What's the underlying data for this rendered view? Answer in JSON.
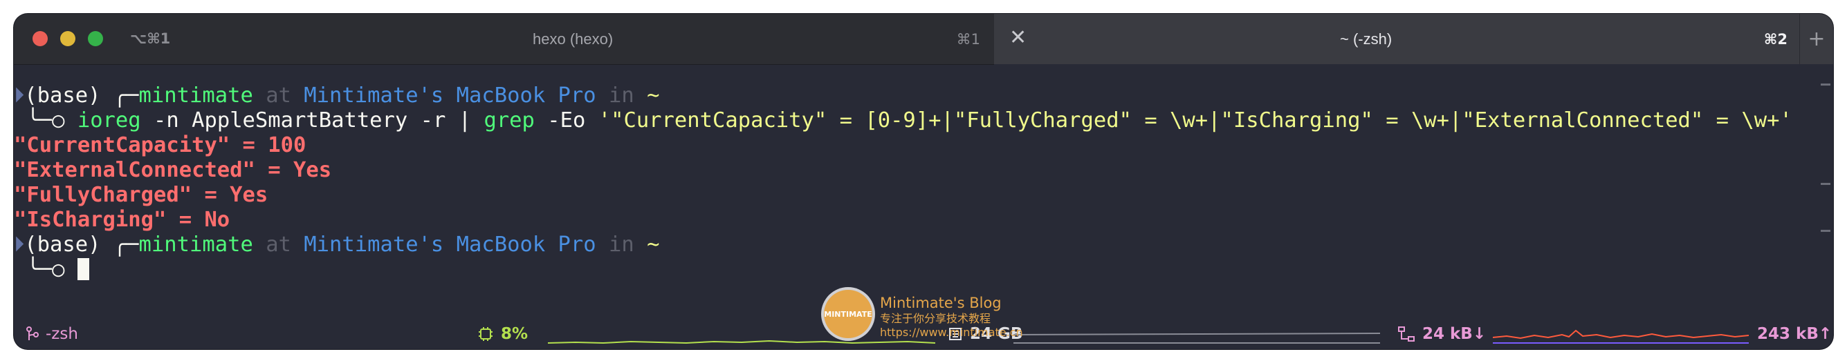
{
  "titlebar": {
    "left_tab": {
      "kbd_hint": "⌥⌘1",
      "title": "hexo (hexo)",
      "shortcut": "⌘1"
    },
    "right_tab": {
      "title": "~ (-zsh)",
      "shortcut": "⌘2"
    }
  },
  "terminal": {
    "line1": {
      "env": "(base)",
      "corner": "╭─",
      "user": "mintimate",
      "at": "at",
      "host": "Mintimate's MacBook Pro",
      "in": "in",
      "dir": "~"
    },
    "line2": {
      "corner": "╰─○ ",
      "cmd": "ioreg",
      "args": " -n AppleSmartBattery -r | ",
      "grep": "grep",
      "grep_flag": " -Eo ",
      "pattern": "'\"CurrentCapacity\" = [0-9]+|\"FullyCharged\" = \\w+|\"IsCharging\" = \\w+|\"ExternalConnected\" = \\w+'"
    },
    "output": [
      "\"CurrentCapacity\" = 100",
      "\"ExternalConnected\" = Yes",
      "\"FullyCharged\" = Yes",
      "\"IsCharging\" = No"
    ],
    "line7": {
      "env": "(base)",
      "corner": "╭─",
      "user": "mintimate",
      "at": "at",
      "host": "Mintimate's MacBook Pro",
      "in": "in",
      "dir": "~"
    },
    "line8": {
      "corner": "╰─○ "
    }
  },
  "statusbar": {
    "shell": "-zsh",
    "cpu": "8%",
    "ram": "24 GB",
    "net_down": "24 kB↓",
    "net_up": "243 kB↑"
  },
  "watermark": {
    "logo_text": "MINTIMATE",
    "title": "Mintimate's Blog",
    "subtitle": "专注于你分享技术教程",
    "url": "https://www.mintimate.cn"
  },
  "colors": {
    "terminal_bg": "#282a36",
    "green": "#50fa7b",
    "blue": "#4a90e2",
    "yellow": "#f1fa8c",
    "output_red": "#ff6e6e",
    "status_pink": "#e89ad6",
    "cpu_green": "#b4e04e"
  }
}
